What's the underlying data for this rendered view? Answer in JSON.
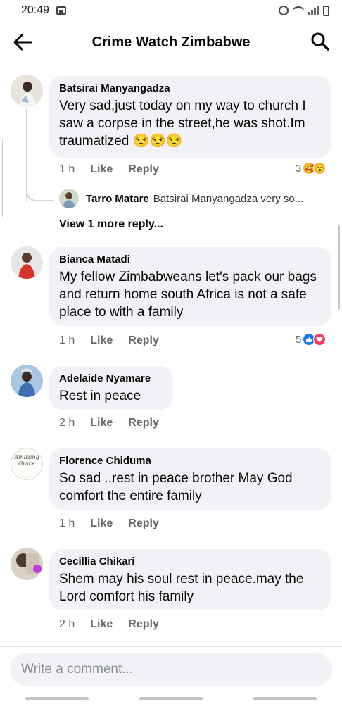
{
  "status_bar": {
    "time": "20:49"
  },
  "header": {
    "title": "Crime Watch Zimbabwe"
  },
  "comments": [
    {
      "author": "Batsirai Manyangadza",
      "text": "Very sad,just today on my way to church I saw a corpse in the street,he was shot.Im traumatized 😒😒😒",
      "time": "1 h",
      "like": "Like",
      "reply": "Reply",
      "reaction_count": "3",
      "reactions": [
        "care-icon",
        "wow-icon"
      ]
    },
    {
      "author": "Bianca Matadi",
      "text": "My fellow Zimbabweans let's pack our bags and return home south Africa is not a safe place to with a family",
      "time": "1 h",
      "like": "Like",
      "reply": "Reply",
      "reaction_count": "5",
      "reactions": [
        "like-icon",
        "love-icon"
      ]
    },
    {
      "author": "Adelaide Nyamare",
      "text": "Rest in peace",
      "time": "2 h",
      "like": "Like",
      "reply": "Reply"
    },
    {
      "author": "Florence Chiduma",
      "text": "So sad ..rest in peace brother  May God comfort the entire family",
      "time": "1 h",
      "like": "Like",
      "reply": "Reply",
      "avatar_text": "Amazing Grace"
    },
    {
      "author": "Cecillia Chikari",
      "text": "Shem may his soul rest in peace.may the Lord comfort his family",
      "time": "2 h",
      "like": "Like",
      "reply": "Reply"
    }
  ],
  "reply_preview": {
    "author": "Tarro Matare",
    "snippet": "Batsirai Manyangadza very so...",
    "view_more": "View 1 more reply..."
  },
  "composer": {
    "placeholder": "Write a comment..."
  },
  "colors": {
    "bubble": "#f0f2f5",
    "meta": "#65676b",
    "like_blue": "#1877f2",
    "love_red": "#f33e58"
  }
}
